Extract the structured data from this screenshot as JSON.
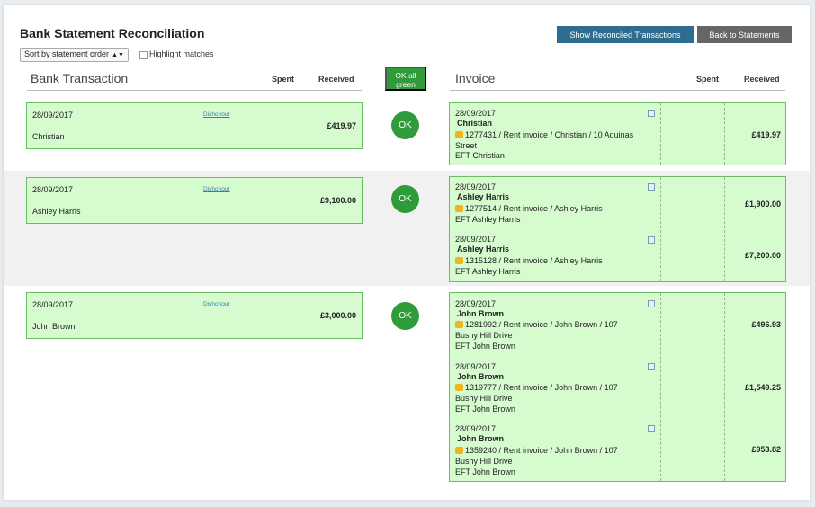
{
  "header": {
    "title": "Bank Statement Reconciliation",
    "show_reconciled_label": "Show Reconciled Transactions",
    "back_label": "Back to Statements",
    "sort_value": "Sort by statement order",
    "highlight_label": "Highlight matches"
  },
  "bank": {
    "title": "Bank Transaction",
    "spent": "Spent",
    "received": "Received"
  },
  "ok_all_label_1": "OK all",
  "ok_all_label_2": "green",
  "invoice": {
    "title": "Invoice",
    "spent": "Spent",
    "received": "Received"
  },
  "dishonour_label": "Dishonour",
  "ok_label": "OK",
  "colors": {
    "row_green": "#d6fbcf",
    "border_green": "#6dbb64",
    "ok_green": "#2f9b3a",
    "primary_button": "#2e6d8f",
    "secondary_button": "#666666"
  },
  "groups": [
    {
      "bank": {
        "date": "28/09/2017",
        "name": "Christian",
        "received": "£419.97"
      },
      "invoices": [
        {
          "date": "28/09/2017",
          "name": "Christian",
          "ref_line1": "1277431 / Rent invoice / Christian / 10 Aquinas",
          "ref_line2": "Street",
          "eft": "EFT Christian",
          "received": "£419.97"
        }
      ]
    },
    {
      "bank": {
        "date": "28/09/2017",
        "name": "Ashley Harris",
        "received": "£9,100.00"
      },
      "invoices": [
        {
          "date": "28/09/2017",
          "name": "Ashley Harris",
          "ref_line1": "1277514 / Rent invoice / Ashley Harris",
          "eft": "EFT Ashley Harris",
          "received": "£1,900.00"
        },
        {
          "date": "28/09/2017",
          "name": "Ashley Harris",
          "ref_line1": "1315128 / Rent invoice / Ashley Harris",
          "eft": "EFT Ashley Harris",
          "received": "£7,200.00"
        }
      ]
    },
    {
      "bank": {
        "date": "28/09/2017",
        "name": "John Brown",
        "received": "£3,000.00"
      },
      "invoices": [
        {
          "date": "28/09/2017",
          "name": "John Brown",
          "ref_line1": "1281992 / Rent invoice / John Brown / 107",
          "ref_line2": "Bushy Hill Drive",
          "eft": "EFT John Brown",
          "received": "£496.93"
        },
        {
          "date": "28/09/2017",
          "name": "John Brown",
          "ref_line1": "1319777 / Rent invoice / John Brown / 107",
          "ref_line2": "Bushy Hill Drive",
          "eft": "EFT John Brown",
          "received": "£1,549.25"
        },
        {
          "date": "28/09/2017",
          "name": "John Brown",
          "ref_line1": "1359240 / Rent invoice / John Brown / 107",
          "ref_line2": "Bushy Hill Drive",
          "eft": "EFT John Brown",
          "received": "£953.82"
        }
      ]
    }
  ]
}
